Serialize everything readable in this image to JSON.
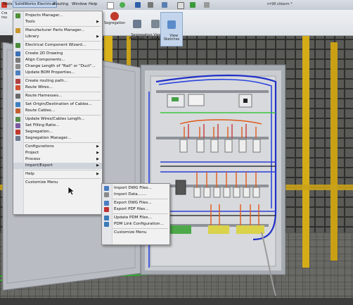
{
  "menubar": {
    "items": [
      "Tools",
      "SolidWorks Electrical",
      "Routing",
      "Window",
      "Help"
    ],
    "window_title": "rrr98.sldasm *"
  },
  "ribbon": {
    "left_stub": "Cre\nrou",
    "buttons": [
      {
        "label": "Segregation",
        "icon_color": "#c0392b"
      },
      {
        "label": "Segregation\nManager",
        "icon_color": "#6b7a8f"
      },
      {
        "label": "View\nAxes",
        "icon_color": "#7b8794"
      },
      {
        "label": "View\nSketches",
        "icon_color": "#5b8bc9"
      }
    ]
  },
  "main_menu": {
    "items": [
      {
        "label": "Projects Manager...",
        "icon": "projects-manager-icon",
        "color": "#4f8f3a"
      },
      {
        "label": "Tools",
        "submenu": true
      },
      {
        "sep": true
      },
      {
        "label": "Manufacturer Parts Manager...",
        "icon": "parts-manager-icon",
        "color": "#c8962b"
      },
      {
        "label": "Library",
        "submenu": true
      },
      {
        "sep": true
      },
      {
        "label": "Electrical Component Wizard...",
        "icon": "component-wizard-icon",
        "color": "#4a8a3a"
      },
      {
        "sep": true
      },
      {
        "label": "Create 2D Drawing",
        "icon": "drawing-icon",
        "color": "#3b6fb6"
      },
      {
        "label": "Align Components...",
        "icon": "align-icon",
        "color": "#7a7a7a"
      },
      {
        "label": "Change Length of \"Rail\" or \"Duct\"...",
        "icon": "rail-icon",
        "color": "#8a8a8a"
      },
      {
        "label": "Update BOM Properties...",
        "icon": "bom-icon",
        "color": "#4d7fbf"
      },
      {
        "sep": true
      },
      {
        "label": "Create routing path...",
        "icon": "routing-path-icon",
        "color": "#b04040"
      },
      {
        "label": "Route Wires...",
        "icon": "route-wires-icon",
        "color": "#d05030"
      },
      {
        "sep": true
      },
      {
        "label": "Route Harnesses...",
        "icon": "route-harness-icon",
        "color": "#6a6a6a"
      },
      {
        "sep": true
      },
      {
        "label": "Set Origin/Destination of Cables...",
        "icon": "origin-icon",
        "color": "#3f7fc0"
      },
      {
        "label": "Route Cables...",
        "icon": "route-cables-icon",
        "color": "#c06030"
      },
      {
        "sep": true
      },
      {
        "label": "Update Wires/Cables Length...",
        "icon": "update-length-icon",
        "color": "#5a8a4a"
      },
      {
        "label": "Set Filling Ratio...",
        "icon": "filling-ratio-icon",
        "color": "#7a5aa0"
      },
      {
        "label": "Segregation...",
        "icon": "segregation-icon",
        "color": "#c0392b"
      },
      {
        "label": "Segregation Manager...",
        "icon": "segregation-manager-icon",
        "color": "#6b7a8f"
      },
      {
        "sep": true
      },
      {
        "label": "Configurations",
        "submenu": true
      },
      {
        "label": "Project",
        "submenu": true
      },
      {
        "label": "Process",
        "submenu": true
      },
      {
        "label": "Import/Export",
        "submenu": true,
        "highlight": true
      },
      {
        "sep": true
      },
      {
        "label": "Help",
        "submenu": true
      },
      {
        "sep": true
      },
      {
        "label": "Customize Menu"
      }
    ]
  },
  "sub_menu": {
    "items": [
      {
        "label": "Import DWG Files...",
        "icon": "import-dwg-icon",
        "color": "#4a7cc0"
      },
      {
        "label": "Import Data.......",
        "icon": "import-data-icon",
        "color": "#8a8a8a"
      },
      {
        "sep": true
      },
      {
        "label": "Export DWG Files...",
        "icon": "export-dwg-icon",
        "color": "#4a7cc0"
      },
      {
        "label": "Export PDF files...",
        "icon": "export-pdf-icon",
        "color": "#c03030"
      },
      {
        "sep": true
      },
      {
        "label": "Update PDM Files...",
        "icon": "update-pdm-icon",
        "color": "#3a7ab8"
      },
      {
        "label": "PDM Link Configuration...",
        "icon": "pdm-link-icon",
        "color": "#3a7ab8"
      },
      {
        "sep": true
      },
      {
        "label": "Customize Menu"
      }
    ]
  }
}
